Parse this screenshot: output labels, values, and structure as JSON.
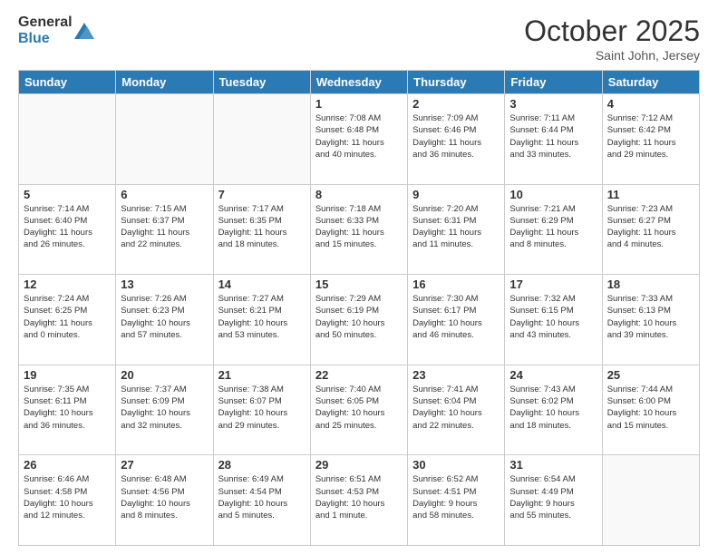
{
  "header": {
    "logo_general": "General",
    "logo_blue": "Blue",
    "month_title": "October 2025",
    "location": "Saint John, Jersey"
  },
  "weekdays": [
    "Sunday",
    "Monday",
    "Tuesday",
    "Wednesday",
    "Thursday",
    "Friday",
    "Saturday"
  ],
  "weeks": [
    [
      {
        "day": "",
        "info": ""
      },
      {
        "day": "",
        "info": ""
      },
      {
        "day": "",
        "info": ""
      },
      {
        "day": "1",
        "info": "Sunrise: 7:08 AM\nSunset: 6:48 PM\nDaylight: 11 hours\nand 40 minutes."
      },
      {
        "day": "2",
        "info": "Sunrise: 7:09 AM\nSunset: 6:46 PM\nDaylight: 11 hours\nand 36 minutes."
      },
      {
        "day": "3",
        "info": "Sunrise: 7:11 AM\nSunset: 6:44 PM\nDaylight: 11 hours\nand 33 minutes."
      },
      {
        "day": "4",
        "info": "Sunrise: 7:12 AM\nSunset: 6:42 PM\nDaylight: 11 hours\nand 29 minutes."
      }
    ],
    [
      {
        "day": "5",
        "info": "Sunrise: 7:14 AM\nSunset: 6:40 PM\nDaylight: 11 hours\nand 26 minutes."
      },
      {
        "day": "6",
        "info": "Sunrise: 7:15 AM\nSunset: 6:37 PM\nDaylight: 11 hours\nand 22 minutes."
      },
      {
        "day": "7",
        "info": "Sunrise: 7:17 AM\nSunset: 6:35 PM\nDaylight: 11 hours\nand 18 minutes."
      },
      {
        "day": "8",
        "info": "Sunrise: 7:18 AM\nSunset: 6:33 PM\nDaylight: 11 hours\nand 15 minutes."
      },
      {
        "day": "9",
        "info": "Sunrise: 7:20 AM\nSunset: 6:31 PM\nDaylight: 11 hours\nand 11 minutes."
      },
      {
        "day": "10",
        "info": "Sunrise: 7:21 AM\nSunset: 6:29 PM\nDaylight: 11 hours\nand 8 minutes."
      },
      {
        "day": "11",
        "info": "Sunrise: 7:23 AM\nSunset: 6:27 PM\nDaylight: 11 hours\nand 4 minutes."
      }
    ],
    [
      {
        "day": "12",
        "info": "Sunrise: 7:24 AM\nSunset: 6:25 PM\nDaylight: 11 hours\nand 0 minutes."
      },
      {
        "day": "13",
        "info": "Sunrise: 7:26 AM\nSunset: 6:23 PM\nDaylight: 10 hours\nand 57 minutes."
      },
      {
        "day": "14",
        "info": "Sunrise: 7:27 AM\nSunset: 6:21 PM\nDaylight: 10 hours\nand 53 minutes."
      },
      {
        "day": "15",
        "info": "Sunrise: 7:29 AM\nSunset: 6:19 PM\nDaylight: 10 hours\nand 50 minutes."
      },
      {
        "day": "16",
        "info": "Sunrise: 7:30 AM\nSunset: 6:17 PM\nDaylight: 10 hours\nand 46 minutes."
      },
      {
        "day": "17",
        "info": "Sunrise: 7:32 AM\nSunset: 6:15 PM\nDaylight: 10 hours\nand 43 minutes."
      },
      {
        "day": "18",
        "info": "Sunrise: 7:33 AM\nSunset: 6:13 PM\nDaylight: 10 hours\nand 39 minutes."
      }
    ],
    [
      {
        "day": "19",
        "info": "Sunrise: 7:35 AM\nSunset: 6:11 PM\nDaylight: 10 hours\nand 36 minutes."
      },
      {
        "day": "20",
        "info": "Sunrise: 7:37 AM\nSunset: 6:09 PM\nDaylight: 10 hours\nand 32 minutes."
      },
      {
        "day": "21",
        "info": "Sunrise: 7:38 AM\nSunset: 6:07 PM\nDaylight: 10 hours\nand 29 minutes."
      },
      {
        "day": "22",
        "info": "Sunrise: 7:40 AM\nSunset: 6:05 PM\nDaylight: 10 hours\nand 25 minutes."
      },
      {
        "day": "23",
        "info": "Sunrise: 7:41 AM\nSunset: 6:04 PM\nDaylight: 10 hours\nand 22 minutes."
      },
      {
        "day": "24",
        "info": "Sunrise: 7:43 AM\nSunset: 6:02 PM\nDaylight: 10 hours\nand 18 minutes."
      },
      {
        "day": "25",
        "info": "Sunrise: 7:44 AM\nSunset: 6:00 PM\nDaylight: 10 hours\nand 15 minutes."
      }
    ],
    [
      {
        "day": "26",
        "info": "Sunrise: 6:46 AM\nSunset: 4:58 PM\nDaylight: 10 hours\nand 12 minutes."
      },
      {
        "day": "27",
        "info": "Sunrise: 6:48 AM\nSunset: 4:56 PM\nDaylight: 10 hours\nand 8 minutes."
      },
      {
        "day": "28",
        "info": "Sunrise: 6:49 AM\nSunset: 4:54 PM\nDaylight: 10 hours\nand 5 minutes."
      },
      {
        "day": "29",
        "info": "Sunrise: 6:51 AM\nSunset: 4:53 PM\nDaylight: 10 hours\nand 1 minute."
      },
      {
        "day": "30",
        "info": "Sunrise: 6:52 AM\nSunset: 4:51 PM\nDaylight: 9 hours\nand 58 minutes."
      },
      {
        "day": "31",
        "info": "Sunrise: 6:54 AM\nSunset: 4:49 PM\nDaylight: 9 hours\nand 55 minutes."
      },
      {
        "day": "",
        "info": ""
      }
    ]
  ]
}
